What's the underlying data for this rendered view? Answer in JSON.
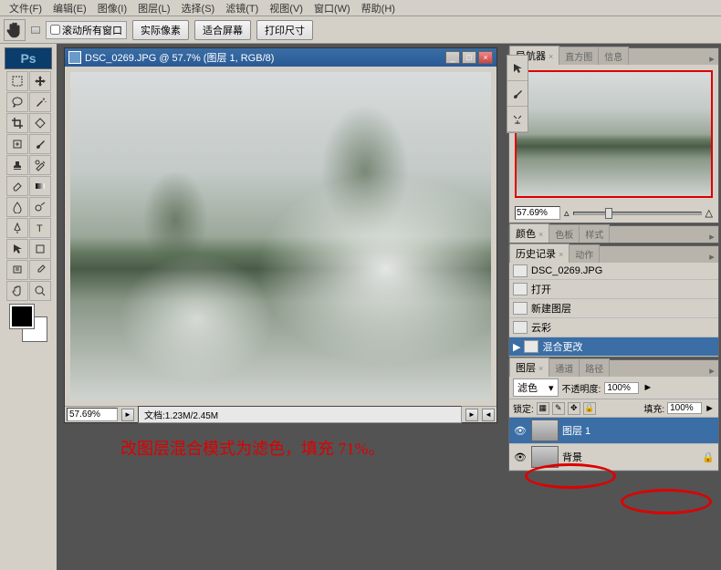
{
  "menu": {
    "file": "文件(F)",
    "edit": "编辑(E)",
    "image": "图像(I)",
    "layer": "图层(L)",
    "select": "选择(S)",
    "filter": "滤镜(T)",
    "view": "视图(V)",
    "window": "窗口(W)",
    "help": "帮助(H)"
  },
  "optionbar": {
    "scroll_all": "滚动所有窗口",
    "actual": "实际像素",
    "fit": "适合屏幕",
    "print": "打印尺寸"
  },
  "doc": {
    "title": "DSC_0269.JPG @ 57.7% (图层 1, RGB/8)",
    "zoom": "57.69%",
    "docinfo": "文档:1.23M/2.45M"
  },
  "annotation": "改图层混合模式为滤色，填充 71%。",
  "panels": {
    "navigator": {
      "tab1": "导航器",
      "tab2": "直方图",
      "tab3": "信息",
      "zoom": "57.69%"
    },
    "color": {
      "tab1": "颜色",
      "tab2": "色板",
      "tab3": "样式"
    },
    "history": {
      "tab1": "历史记录",
      "tab2": "动作",
      "items": [
        "打开",
        "新建图层",
        "云彩",
        "混合更改"
      ]
    },
    "layers": {
      "tab1": "图层",
      "tab2": "通道",
      "tab3": "路径",
      "blend": "滤色",
      "opacity_lbl": "不透明度:",
      "opacity": "100%",
      "lock_lbl": "锁定:",
      "fill_lbl": "填充:",
      "fill": "100%",
      "layer1": "图层 1",
      "bg": "背景"
    }
  },
  "icons": {
    "min": "_",
    "max": "□",
    "close": "×",
    "playL": "◄",
    "playR": "►",
    "dd": "▾",
    "eye": "👁"
  }
}
